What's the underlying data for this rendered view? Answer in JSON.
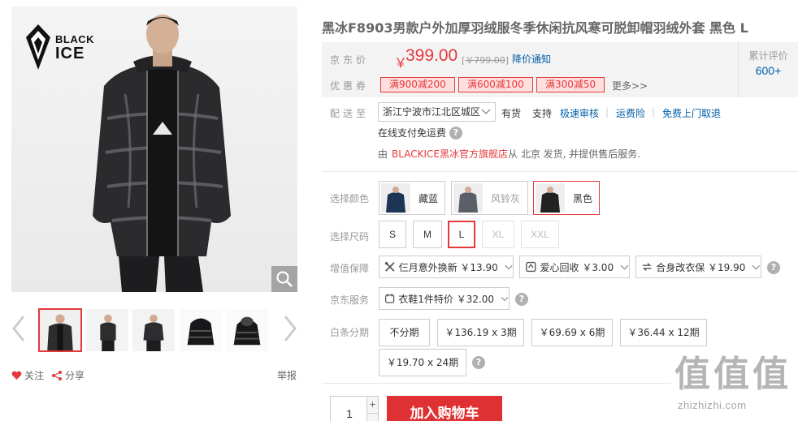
{
  "brand": {
    "logo_line1": "BLACK",
    "logo_line2": "ICE"
  },
  "gallery": {
    "thumbnails": [
      "thumb-front",
      "thumb-side",
      "thumb-front-2",
      "thumb-jacket-back",
      "thumb-jacket-front"
    ],
    "active_index": 0
  },
  "actions": {
    "follow": "关注",
    "share": "分享",
    "report": "举报"
  },
  "product": {
    "title": "黑冰F8903男款户外加厚羽绒服冬季休闲抗风寒可脱卸帽羽绒外套 黑色 L"
  },
  "summary": {
    "price_label": "京东价",
    "currency": "￥",
    "price": "399.00",
    "old_price": "￥799.00",
    "old_price_open": "[",
    "old_price_close": "]",
    "notify": "降价通知",
    "coupon_label": "优惠券",
    "coupons": [
      "满900减200",
      "满600减100",
      "满300减50"
    ],
    "more": "更多>>",
    "rating_label": "累计评价",
    "rating_value": "600+"
  },
  "delivery": {
    "label": "配送至",
    "address": "浙江宁波市江北区城区",
    "stock": "有货",
    "support": "支持",
    "services": [
      "极速审核",
      "运费险",
      "免费上门取退"
    ],
    "separator": "|",
    "payment": "在线支付免运费",
    "from_prefix": "由",
    "store": "BLACKICE黑冰官方旗舰店",
    "from_suffix": "从 北京 发货, 并提供售后服务."
  },
  "color": {
    "label": "选择颜色",
    "options": [
      "藏蓝",
      "风铃灰",
      "黑色"
    ],
    "selected": "黑色"
  },
  "size": {
    "label": "选择尺码",
    "options": [
      "S",
      "M",
      "L",
      "XL",
      "XXL"
    ],
    "selected": "L",
    "disabled": [
      "XL",
      "XXL"
    ]
  },
  "warranty": {
    "label": "增值保障",
    "items": [
      "仨月意外换新 ￥13.90",
      "爱心回收 ￥3.00",
      "合身改衣保 ￥19.90"
    ]
  },
  "jd_service": {
    "label": "京东服务",
    "items": [
      "衣鞋1件特价 ￥32.00"
    ]
  },
  "installment": {
    "label": "白条分期",
    "options": [
      "不分期",
      "￥136.19 x 3期",
      "￥69.69 x 6期",
      "￥36.44 x 12期",
      "￥19.70 x 24期"
    ]
  },
  "purchase": {
    "quantity": "1",
    "plus": "+",
    "cart_label": "加入购物车"
  },
  "watermark": {
    "chars": "值值值",
    "url": "zhizhizhi.com"
  },
  "colors": {
    "accent": "#e4393c",
    "link": "#005ea7",
    "panel": "#f3f3f3"
  }
}
